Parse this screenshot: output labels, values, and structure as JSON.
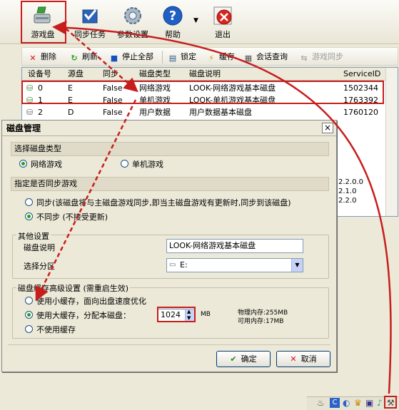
{
  "toolbar": {
    "items": [
      {
        "label": "游戏盘",
        "icon": "game-disk-icon"
      },
      {
        "label": "同步任务",
        "icon": "sync-task-icon"
      },
      {
        "label": "参数设置",
        "icon": "gear-icon"
      },
      {
        "label": "帮助",
        "icon": "help-icon"
      },
      {
        "label": "退出",
        "icon": "exit-icon"
      }
    ]
  },
  "toolbar2": {
    "delete": "删除",
    "refresh": "刷新",
    "stop_all": "停止全部",
    "lock": "锁定",
    "cache": "缓存",
    "session_query": "会话查询",
    "game_sync": "游戏同步"
  },
  "device_list": {
    "columns": [
      "设备号",
      "源盘",
      "同步",
      "磁盘类型",
      "磁盘说明",
      "ServiceID"
    ],
    "rows": [
      {
        "id": "0",
        "src": "E",
        "sync": "False",
        "type": "网络游戏",
        "desc": "LOOK-网络游戏基本磁盘",
        "sid": "1502344"
      },
      {
        "id": "1",
        "src": "E",
        "sync": "False",
        "type": "单机游戏",
        "desc": "LOOK-单机游戏基本磁盘",
        "sid": "1763392"
      },
      {
        "id": "2",
        "src": "D",
        "sync": "False",
        "type": "用户数据",
        "desc": "用户数据基本磁盘",
        "sid": "1760120"
      }
    ]
  },
  "versions": [
    "2.2.0.0",
    "2.1.0",
    "2.2.0"
  ],
  "dialog": {
    "title": "磁盘管理",
    "close": "×",
    "disk_type": {
      "header": "选择磁盘类型",
      "options": [
        "网络游戏",
        "单机游戏"
      ],
      "selected": 0
    },
    "sync": {
      "header": "指定是否同步游戏",
      "options": [
        "同步(该磁盘将与主磁盘游戏同步,即当主磁盘游戏有更新时,同步到该磁盘)",
        "不同步 (不接受更新)"
      ],
      "selected": 1
    },
    "other": {
      "legend": "其他设置",
      "desc_label": "磁盘说明",
      "desc_value": "LOOK-网络游戏基本磁盘",
      "partition_label": "选择分区",
      "partition_value": "E:"
    },
    "cache": {
      "legend": "磁盘缓存高级设置 (需重启生效)",
      "options": [
        "使用小缓存，面向出盘速度优化",
        "使用大缓存，分配本磁盘：",
        "不使用缓存"
      ],
      "selected": 1,
      "size_value": "1024",
      "size_unit": "MB",
      "physical_mem": "物理内存:255MB",
      "available_mem": "可用内存:17MB"
    },
    "ok_label": "确定",
    "cancel_label": "取消"
  },
  "colors": {
    "highlight": "#c81d1d",
    "radio_dot": "#21a121"
  }
}
